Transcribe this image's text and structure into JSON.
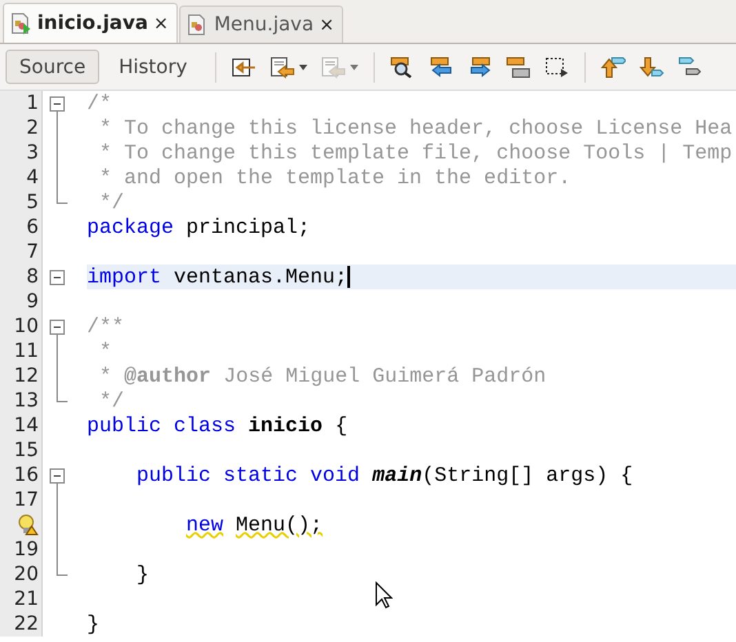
{
  "tabs": [
    {
      "label": "inicio.java",
      "selected": true,
      "close": "×"
    },
    {
      "label": "Menu.java",
      "selected": false,
      "close": "×"
    }
  ],
  "toolbar": {
    "views": [
      {
        "label": "Source",
        "selected": true
      },
      {
        "label": "History",
        "selected": false
      }
    ],
    "tools": [
      {
        "kind": "back-edit",
        "dropdown": false,
        "disabled": false
      },
      {
        "kind": "prev-edit",
        "dropdown": true,
        "disabled": false
      },
      {
        "kind": "next-edit",
        "dropdown": true,
        "disabled": true
      },
      {
        "kind": "find",
        "dropdown": false,
        "disabled": false
      },
      {
        "kind": "find-prev",
        "dropdown": false,
        "disabled": false
      },
      {
        "kind": "find-next",
        "dropdown": false,
        "disabled": false
      },
      {
        "kind": "highlight",
        "dropdown": false,
        "disabled": false
      },
      {
        "kind": "rect-select",
        "dropdown": false,
        "disabled": false
      },
      {
        "kind": "bookmark-prev",
        "dropdown": false,
        "disabled": false
      },
      {
        "kind": "bookmark-next",
        "dropdown": false,
        "disabled": false
      },
      {
        "kind": "bookmark-toggle",
        "dropdown": false,
        "disabled": false
      }
    ]
  },
  "editor": {
    "lines": [
      {
        "number": "1",
        "kind": "fold-start",
        "tokens": [
          {
            "kind": "comment",
            "text": "/*"
          }
        ]
      },
      {
        "number": "2",
        "kind": "fold-inside",
        "tokens": [
          {
            "kind": "comment",
            "text": " * To change this license header, choose License Hea"
          }
        ]
      },
      {
        "number": "3",
        "kind": "fold-inside",
        "tokens": [
          {
            "kind": "comment",
            "text": " * To change this template file, choose Tools | Temp"
          }
        ]
      },
      {
        "number": "4",
        "kind": "fold-inside",
        "tokens": [
          {
            "kind": "comment",
            "text": " * and open the template in the editor."
          }
        ]
      },
      {
        "number": "5",
        "kind": "fold-end",
        "tokens": [
          {
            "kind": "comment",
            "text": " */"
          }
        ]
      },
      {
        "number": "6",
        "kind": "plain",
        "tokens": [
          {
            "kind": "keyword",
            "text": "package"
          },
          {
            "kind": "text",
            "text": " principal;"
          }
        ]
      },
      {
        "number": "7",
        "kind": "plain"
      },
      {
        "number": "8",
        "kind": "fold-start",
        "current": true,
        "tokens": [
          {
            "kind": "keyword",
            "text": "import"
          },
          {
            "kind": "text",
            "text": " ventanas.Menu;"
          }
        ]
      },
      {
        "number": "9",
        "kind": "plain"
      },
      {
        "number": "10",
        "kind": "fold-start",
        "tokens": [
          {
            "kind": "comment",
            "text": "/**"
          }
        ]
      },
      {
        "number": "11",
        "kind": "fold-inside",
        "tokens": [
          {
            "kind": "comment",
            "text": " *"
          }
        ]
      },
      {
        "number": "12",
        "kind": "fold-inside",
        "tokens": [
          {
            "kind": "comment",
            "text": " * "
          },
          {
            "kind": "tag",
            "text": "@author"
          },
          {
            "kind": "comment",
            "text": " José Miguel Guimerá Padrón"
          }
        ]
      },
      {
        "number": "13",
        "kind": "fold-end",
        "tokens": [
          {
            "kind": "comment",
            "text": " */"
          }
        ]
      },
      {
        "number": "14",
        "kind": "plain",
        "tokens": [
          {
            "kind": "keyword",
            "text": "public class"
          },
          {
            "kind": "classname",
            "text": " inicio"
          },
          {
            "kind": "text",
            "text": " {"
          }
        ]
      },
      {
        "number": "15",
        "kind": "plain"
      },
      {
        "number": "16",
        "kind": "fold-start",
        "tokens": [
          {
            "kind": "keyword",
            "text": "    public static void"
          },
          {
            "kind": "method",
            "text": " main"
          },
          {
            "kind": "text",
            "text": "(String[] args) {"
          }
        ]
      },
      {
        "number": "17",
        "kind": "fold-inside"
      },
      {
        "hint": true,
        "kind": "fold-inside",
        "tokens": [
          {
            "kind": "keyword",
            "text": "        new",
            "warning": true
          },
          {
            "kind": "text",
            "text": " Menu();",
            "warning": true
          }
        ]
      },
      {
        "number": "19",
        "kind": "fold-inside"
      },
      {
        "number": "20",
        "kind": "fold-end",
        "tokens": [
          {
            "kind": "text",
            "text": "    }"
          }
        ]
      },
      {
        "number": "21",
        "kind": "plain"
      },
      {
        "number": "22",
        "kind": "plain",
        "tokens": [
          {
            "kind": "text",
            "text": "}"
          }
        ]
      }
    ]
  }
}
